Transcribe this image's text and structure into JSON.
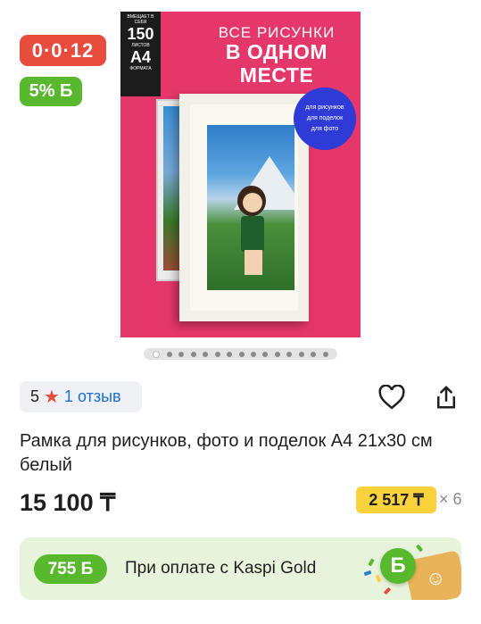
{
  "badges": {
    "timer": "0·0·12",
    "bonus": "5% Б"
  },
  "product_image": {
    "headline": [
      "ВСЕ РИСУНКИ",
      "В ОДНОМ",
      "МЕСТЕ"
    ],
    "spec": {
      "top": "ВМЕЩАЕТ В СЕБЯ",
      "count": "150",
      "count_unit": "ЛИСТОВ",
      "format": "А4",
      "format_unit": "ФОРМАТА"
    },
    "circle": [
      "для рисунков",
      "для поделок",
      "для фото"
    ]
  },
  "gallery": {
    "total": 15,
    "active": 1
  },
  "rating": {
    "value": "5",
    "reviews": "1 отзыв"
  },
  "icons": {
    "favorite": "heart-icon",
    "share": "share-icon"
  },
  "title": "Рамка для рисунков, фото и поделок А4 21x30 см белый",
  "price": "15 100 ₸",
  "installment": {
    "amount": "2 517 ₸",
    "multiplier": "× 6"
  },
  "kaspi_gold": {
    "bonus": "755 Б",
    "text": "При оплате с Kaspi Gold",
    "coin": "Б"
  },
  "colors": {
    "red": "#e84c3d",
    "green": "#58b82e",
    "yellow": "#fad23c",
    "link": "#1b6fd1"
  }
}
